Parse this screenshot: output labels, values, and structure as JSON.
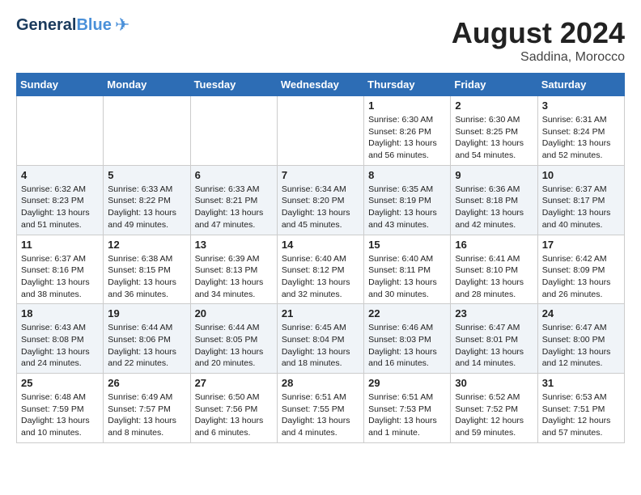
{
  "header": {
    "logo_general": "General",
    "logo_blue": "Blue",
    "month_year": "August 2024",
    "location": "Saddina, Morocco"
  },
  "days_of_week": [
    "Sunday",
    "Monday",
    "Tuesday",
    "Wednesday",
    "Thursday",
    "Friday",
    "Saturday"
  ],
  "weeks": [
    {
      "cells": [
        {
          "day": null,
          "content": ""
        },
        {
          "day": null,
          "content": ""
        },
        {
          "day": null,
          "content": ""
        },
        {
          "day": null,
          "content": ""
        },
        {
          "day": "1",
          "content": "Sunrise: 6:30 AM\nSunset: 8:26 PM\nDaylight: 13 hours and 56 minutes."
        },
        {
          "day": "2",
          "content": "Sunrise: 6:30 AM\nSunset: 8:25 PM\nDaylight: 13 hours and 54 minutes."
        },
        {
          "day": "3",
          "content": "Sunrise: 6:31 AM\nSunset: 8:24 PM\nDaylight: 13 hours and 52 minutes."
        }
      ]
    },
    {
      "cells": [
        {
          "day": "4",
          "content": "Sunrise: 6:32 AM\nSunset: 8:23 PM\nDaylight: 13 hours and 51 minutes."
        },
        {
          "day": "5",
          "content": "Sunrise: 6:33 AM\nSunset: 8:22 PM\nDaylight: 13 hours and 49 minutes."
        },
        {
          "day": "6",
          "content": "Sunrise: 6:33 AM\nSunset: 8:21 PM\nDaylight: 13 hours and 47 minutes."
        },
        {
          "day": "7",
          "content": "Sunrise: 6:34 AM\nSunset: 8:20 PM\nDaylight: 13 hours and 45 minutes."
        },
        {
          "day": "8",
          "content": "Sunrise: 6:35 AM\nSunset: 8:19 PM\nDaylight: 13 hours and 43 minutes."
        },
        {
          "day": "9",
          "content": "Sunrise: 6:36 AM\nSunset: 8:18 PM\nDaylight: 13 hours and 42 minutes."
        },
        {
          "day": "10",
          "content": "Sunrise: 6:37 AM\nSunset: 8:17 PM\nDaylight: 13 hours and 40 minutes."
        }
      ]
    },
    {
      "cells": [
        {
          "day": "11",
          "content": "Sunrise: 6:37 AM\nSunset: 8:16 PM\nDaylight: 13 hours and 38 minutes."
        },
        {
          "day": "12",
          "content": "Sunrise: 6:38 AM\nSunset: 8:15 PM\nDaylight: 13 hours and 36 minutes."
        },
        {
          "day": "13",
          "content": "Sunrise: 6:39 AM\nSunset: 8:13 PM\nDaylight: 13 hours and 34 minutes."
        },
        {
          "day": "14",
          "content": "Sunrise: 6:40 AM\nSunset: 8:12 PM\nDaylight: 13 hours and 32 minutes."
        },
        {
          "day": "15",
          "content": "Sunrise: 6:40 AM\nSunset: 8:11 PM\nDaylight: 13 hours and 30 minutes."
        },
        {
          "day": "16",
          "content": "Sunrise: 6:41 AM\nSunset: 8:10 PM\nDaylight: 13 hours and 28 minutes."
        },
        {
          "day": "17",
          "content": "Sunrise: 6:42 AM\nSunset: 8:09 PM\nDaylight: 13 hours and 26 minutes."
        }
      ]
    },
    {
      "cells": [
        {
          "day": "18",
          "content": "Sunrise: 6:43 AM\nSunset: 8:08 PM\nDaylight: 13 hours and 24 minutes."
        },
        {
          "day": "19",
          "content": "Sunrise: 6:44 AM\nSunset: 8:06 PM\nDaylight: 13 hours and 22 minutes."
        },
        {
          "day": "20",
          "content": "Sunrise: 6:44 AM\nSunset: 8:05 PM\nDaylight: 13 hours and 20 minutes."
        },
        {
          "day": "21",
          "content": "Sunrise: 6:45 AM\nSunset: 8:04 PM\nDaylight: 13 hours and 18 minutes."
        },
        {
          "day": "22",
          "content": "Sunrise: 6:46 AM\nSunset: 8:03 PM\nDaylight: 13 hours and 16 minutes."
        },
        {
          "day": "23",
          "content": "Sunrise: 6:47 AM\nSunset: 8:01 PM\nDaylight: 13 hours and 14 minutes."
        },
        {
          "day": "24",
          "content": "Sunrise: 6:47 AM\nSunset: 8:00 PM\nDaylight: 13 hours and 12 minutes."
        }
      ]
    },
    {
      "cells": [
        {
          "day": "25",
          "content": "Sunrise: 6:48 AM\nSunset: 7:59 PM\nDaylight: 13 hours and 10 minutes."
        },
        {
          "day": "26",
          "content": "Sunrise: 6:49 AM\nSunset: 7:57 PM\nDaylight: 13 hours and 8 minutes."
        },
        {
          "day": "27",
          "content": "Sunrise: 6:50 AM\nSunset: 7:56 PM\nDaylight: 13 hours and 6 minutes."
        },
        {
          "day": "28",
          "content": "Sunrise: 6:51 AM\nSunset: 7:55 PM\nDaylight: 13 hours and 4 minutes."
        },
        {
          "day": "29",
          "content": "Sunrise: 6:51 AM\nSunset: 7:53 PM\nDaylight: 13 hours and 1 minute."
        },
        {
          "day": "30",
          "content": "Sunrise: 6:52 AM\nSunset: 7:52 PM\nDaylight: 12 hours and 59 minutes."
        },
        {
          "day": "31",
          "content": "Sunrise: 6:53 AM\nSunset: 7:51 PM\nDaylight: 12 hours and 57 minutes."
        }
      ]
    }
  ]
}
